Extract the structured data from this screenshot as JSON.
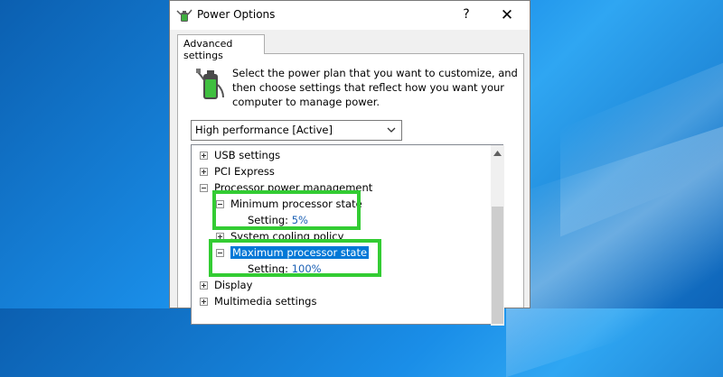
{
  "window": {
    "title": "Power Options",
    "help_label": "?",
    "close_label": "✕"
  },
  "tab": {
    "label": "Advanced settings"
  },
  "description": {
    "lines": [
      "Select the power plan that you want to customize, and",
      "then choose settings that reflect how you want your",
      "computer to manage power."
    ]
  },
  "plan_select": {
    "value": "High performance [Active]"
  },
  "tree": {
    "items": [
      {
        "label": "USB settings",
        "expander": "plus",
        "level": 0
      },
      {
        "label": "PCI Express",
        "expander": "plus",
        "level": 0
      },
      {
        "label": "Processor power management",
        "expander": "minus",
        "level": 0
      },
      {
        "label": "Minimum processor state",
        "expander": "minus",
        "level": 1
      },
      {
        "label": "Setting:",
        "value": "5%",
        "level": 2
      },
      {
        "label": "System cooling policy",
        "expander": "plus",
        "level": 1
      },
      {
        "label": "Maximum processor state",
        "expander": "minus",
        "level": 1,
        "selected": true
      },
      {
        "label": "Setting:",
        "value": "100%",
        "level": 2
      },
      {
        "label": "Display",
        "expander": "plus",
        "level": 0
      },
      {
        "label": "Multimedia settings",
        "expander": "plus",
        "level": 0
      }
    ]
  },
  "colors": {
    "highlight_box": "#33cc33",
    "selection": "#0078d7",
    "setting_value": "#1a5fb4"
  },
  "icons": {
    "title": "power-options-icon",
    "plan": "battery-plug-icon"
  }
}
